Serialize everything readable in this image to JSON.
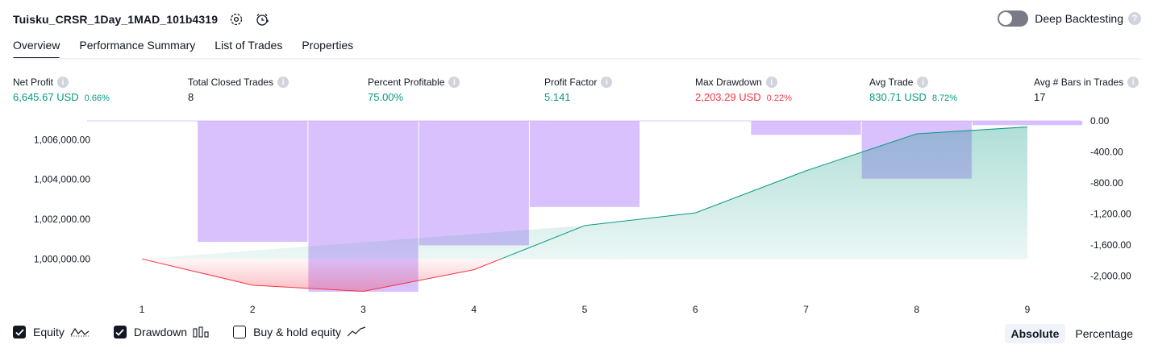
{
  "header": {
    "title": "Tuisku_CRSR_1Day_1MAD_101b4319",
    "deep_backtesting": "Deep Backtesting",
    "deep_backtesting_enabled": false,
    "help": "?"
  },
  "tabs": [
    {
      "label": "Overview",
      "active": true
    },
    {
      "label": "Performance Summary",
      "active": false
    },
    {
      "label": "List of Trades",
      "active": false
    },
    {
      "label": "Properties",
      "active": false
    }
  ],
  "metrics": [
    {
      "label": "Net Profit",
      "value": "6,645.67 USD",
      "pct": "0.66%",
      "tone": "pos"
    },
    {
      "label": "Total Closed Trades",
      "value": "8",
      "pct": "",
      "tone": "plain"
    },
    {
      "label": "Percent Profitable",
      "value": "75.00%",
      "pct": "",
      "tone": "pos"
    },
    {
      "label": "Profit Factor",
      "value": "5.141",
      "pct": "",
      "tone": "pos"
    },
    {
      "label": "Max Drawdown",
      "value": "2,203.29 USD",
      "pct": "0.22%",
      "tone": "neg"
    },
    {
      "label": "Avg Trade",
      "value": "830.71 USD",
      "pct": "8.72%",
      "tone": "pos"
    },
    {
      "label": "Avg # Bars in Trades",
      "value": "17",
      "pct": "",
      "tone": "plain"
    }
  ],
  "chart_data": {
    "type": "line",
    "x": [
      1,
      2,
      3,
      4,
      5,
      6,
      7,
      8,
      9
    ],
    "left_axis": {
      "ticks": [
        1000000,
        1002000,
        1004000,
        1006000
      ],
      "tick_labels": [
        "1,000,000.00",
        "1,002,000.00",
        "1,004,000.00",
        "1,006,000.00"
      ],
      "range": [
        998350,
        1006950
      ]
    },
    "right_axis": {
      "ticks": [
        0,
        -400,
        -800,
        -1200,
        -1600,
        -2000
      ],
      "tick_labels": [
        "0.00",
        "-400.00",
        "-800.00",
        "-1,200.00",
        "-1,600.00",
        "-2,000.00"
      ],
      "range": [
        -2203.29,
        0
      ]
    },
    "series": [
      {
        "name": "Equity",
        "axis": "left",
        "values": [
          1000000,
          998680,
          998370,
          999460,
          1001680,
          1002320,
          1004440,
          1006300,
          1006645.67
        ],
        "color_up": "#089981",
        "color_down": "#f23645"
      },
      {
        "name": "Drawdown",
        "axis": "right",
        "type": "bar",
        "values": [
          0,
          -1560,
          -2203.29,
          -1605,
          -1110,
          0,
          -180,
          -745,
          -55
        ],
        "color": "#c29bfc"
      }
    ],
    "baseline": 1000000,
    "grid": false
  },
  "legend": [
    {
      "label": "Equity",
      "checked": true,
      "icon": "equity-line-icon"
    },
    {
      "label": "Drawdown",
      "checked": true,
      "icon": "drawdown-bars-icon"
    },
    {
      "label": "Buy & hold equity",
      "checked": false,
      "icon": "buy-hold-line-icon"
    }
  ],
  "modes": [
    {
      "label": "Absolute",
      "active": true
    },
    {
      "label": "Percentage",
      "active": false
    }
  ]
}
